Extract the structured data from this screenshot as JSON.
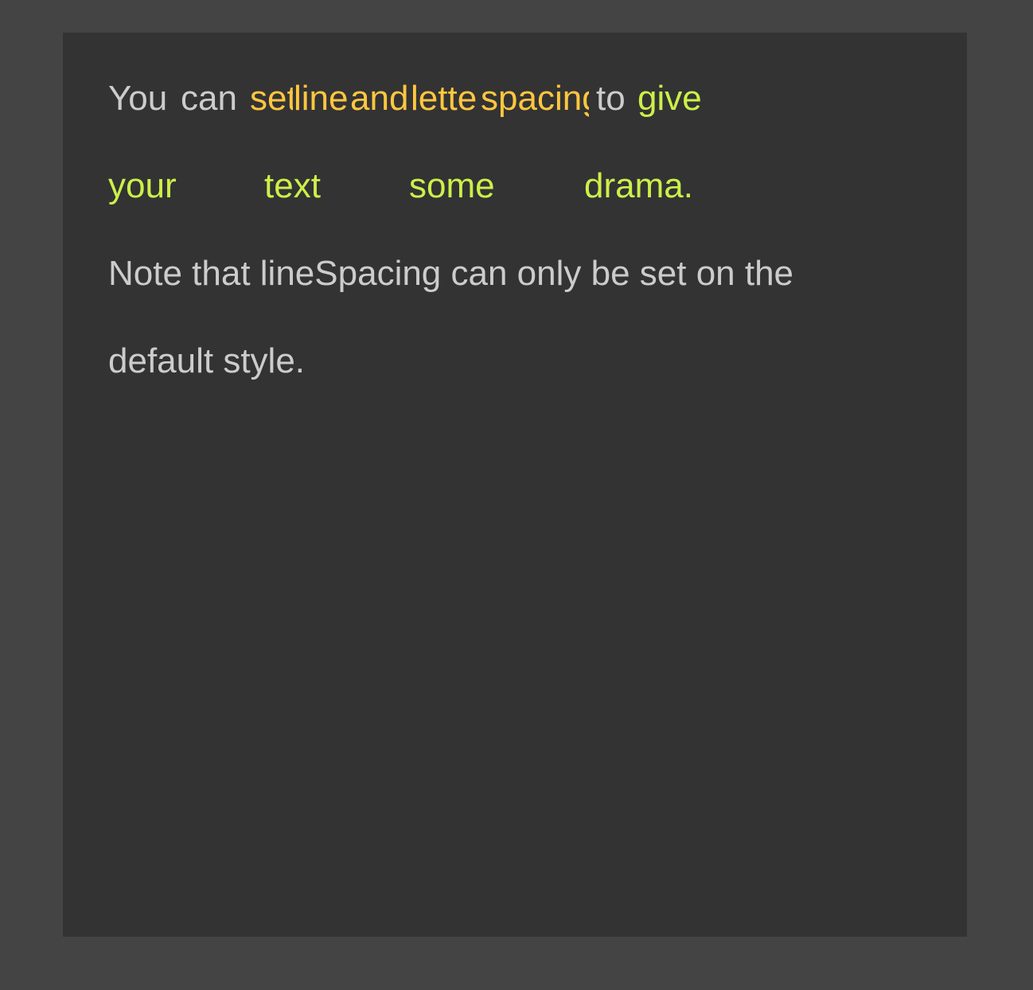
{
  "colors": {
    "page_background": "#444444",
    "canvas_background": "#333333",
    "default_text": "#cccccc",
    "highlight_text": "#ffc640",
    "drama_text": "#ccf04a"
  },
  "paragraph1": {
    "line1": {
      "you": "You",
      "can": "can",
      "set": "set",
      "line": "line",
      "and": "and",
      "letter": "letter",
      "spacing": "spacing",
      "to": "to",
      "give": "give"
    },
    "line2": {
      "your": "your",
      "text": "text",
      "some": "some",
      "drama": "drama."
    }
  },
  "paragraph2": {
    "line3": "Note that lineSpacing can only be set on the",
    "line4": "default style."
  }
}
